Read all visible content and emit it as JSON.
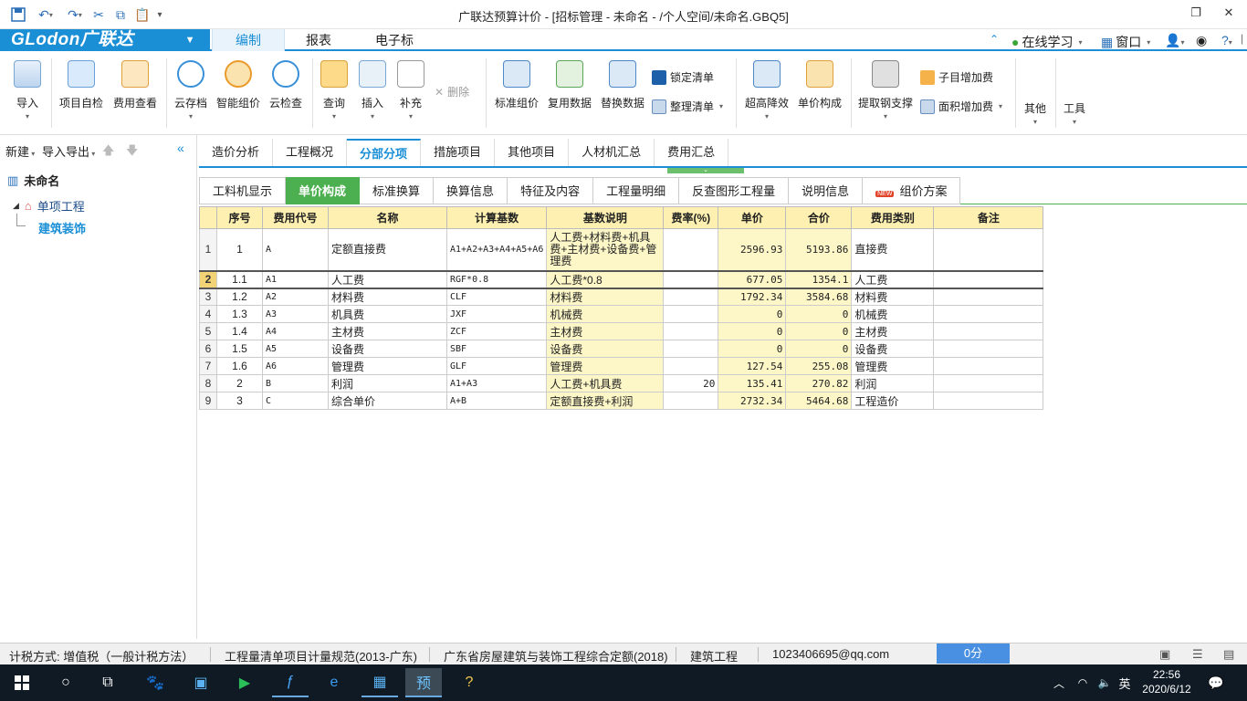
{
  "window": {
    "title": "广联达预算计价 - [招标管理 - 未命名 - /个人空间/未命名.GBQ5]",
    "quick_access": [
      "save-icon",
      "undo-icon",
      "redo-icon",
      "cut-icon",
      "copy-icon",
      "paste-icon",
      "customize-icon"
    ]
  },
  "menubar": {
    "logo": "GLodon广联达",
    "tabs": [
      "编制",
      "报表",
      "电子标"
    ],
    "active_tab": "编制",
    "right": {
      "online": "在线学习",
      "window": "窗口",
      "help": "?"
    }
  },
  "ribbon": {
    "import": "导入",
    "self_check": "项目自检",
    "fee_view": "费用查看",
    "cloud_save": "云存档",
    "smart_price": "智能组价",
    "cloud_check": "云检查",
    "query": "查询",
    "insert": "插入",
    "supplement": "补充",
    "delete": "删除",
    "std_price": "标准组价",
    "reuse_data": "复用数据",
    "replace_data": "替换数据",
    "lock_list": "锁定清单",
    "tidy_list": "整理清单",
    "super_high": "超高降效",
    "unit_price_comp": "单价构成",
    "extract_rebar": "提取钢支撑",
    "sub_add_fee": "子目增加费",
    "area_add_fee": "面积增加费",
    "other": "其他",
    "tools": "工具"
  },
  "leftpanel": {
    "new": "新建",
    "import_export": "导入导出",
    "tree": {
      "root": "未命名",
      "child": "单项工程",
      "leaf": "建筑装饰"
    }
  },
  "main_tabs": [
    "造价分析",
    "工程概况",
    "分部分项",
    "措施项目",
    "其他项目",
    "人材机汇总",
    "费用汇总"
  ],
  "main_active": "分部分项",
  "sub_tabs": [
    "工料机显示",
    "单价构成",
    "标准换算",
    "换算信息",
    "特征及内容",
    "工程量明细",
    "反查图形工程量",
    "说明信息",
    "组价方案"
  ],
  "sub_active": "单价构成",
  "grid": {
    "headers": [
      "序号",
      "费用代号",
      "名称",
      "计算基数",
      "基数说明",
      "费率(%)",
      "单价",
      "合价",
      "费用类别",
      "备注"
    ],
    "rows": [
      {
        "rn": "1",
        "seq": "1",
        "code": "A",
        "name": "定额直接费",
        "base": "A1+A2+A3+A4+A5+A6",
        "desc": "人工费+材料费+机具费+主材费+设备费+管理费",
        "rate": "",
        "price": "2596.93",
        "total": "5193.86",
        "cat": "直接费",
        "note": ""
      },
      {
        "rn": "2",
        "seq": "1.1",
        "code": "A1",
        "name": "人工费",
        "base": "RGF*0.8",
        "desc": "人工费*0.8",
        "rate": "",
        "price": "677.05",
        "total": "1354.1",
        "cat": "人工费",
        "note": ""
      },
      {
        "rn": "3",
        "seq": "1.2",
        "code": "A2",
        "name": "材料费",
        "base": "CLF",
        "desc": "材料费",
        "rate": "",
        "price": "1792.34",
        "total": "3584.68",
        "cat": "材料费",
        "note": ""
      },
      {
        "rn": "4",
        "seq": "1.3",
        "code": "A3",
        "name": "机具费",
        "base": "JXF",
        "desc": "机械费",
        "rate": "",
        "price": "0",
        "total": "0",
        "cat": "机械费",
        "note": ""
      },
      {
        "rn": "5",
        "seq": "1.4",
        "code": "A4",
        "name": "主材费",
        "base": "ZCF",
        "desc": "主材费",
        "rate": "",
        "price": "0",
        "total": "0",
        "cat": "主材费",
        "note": ""
      },
      {
        "rn": "6",
        "seq": "1.5",
        "code": "A5",
        "name": "设备费",
        "base": "SBF",
        "desc": "设备费",
        "rate": "",
        "price": "0",
        "total": "0",
        "cat": "设备费",
        "note": ""
      },
      {
        "rn": "7",
        "seq": "1.6",
        "code": "A6",
        "name": "管理费",
        "base": "GLF",
        "desc": "管理费",
        "rate": "",
        "price": "127.54",
        "total": "255.08",
        "cat": "管理费",
        "note": ""
      },
      {
        "rn": "8",
        "seq": "2",
        "code": "B",
        "name": "利润",
        "base": "A1+A3",
        "desc": "人工费+机具费",
        "rate": "20",
        "price": "135.41",
        "total": "270.82",
        "cat": "利润",
        "note": ""
      },
      {
        "rn": "9",
        "seq": "3",
        "code": "C",
        "name": "综合单价",
        "base": "A+B",
        "desc": "定额直接费+利润",
        "rate": "",
        "price": "2732.34",
        "total": "5464.68",
        "cat": "工程造价",
        "note": ""
      }
    ]
  },
  "statusbar": {
    "tax": "计税方式: 增值税（一般计税方法）",
    "spec": "工程量清单项目计量规范(2013-广东)",
    "quota": "广东省房屋建筑与装饰工程综合定额(2018)",
    "type": "建筑工程",
    "email": "1023406695@qq.com",
    "score": "0分"
  },
  "taskbar": {
    "time": "22:56",
    "date": "2020/6/12",
    "ime": "英"
  },
  "colors": {
    "accent": "#1a8fd6",
    "green_tab": "#4cb050",
    "header_yellow": "#fdf0b0"
  }
}
